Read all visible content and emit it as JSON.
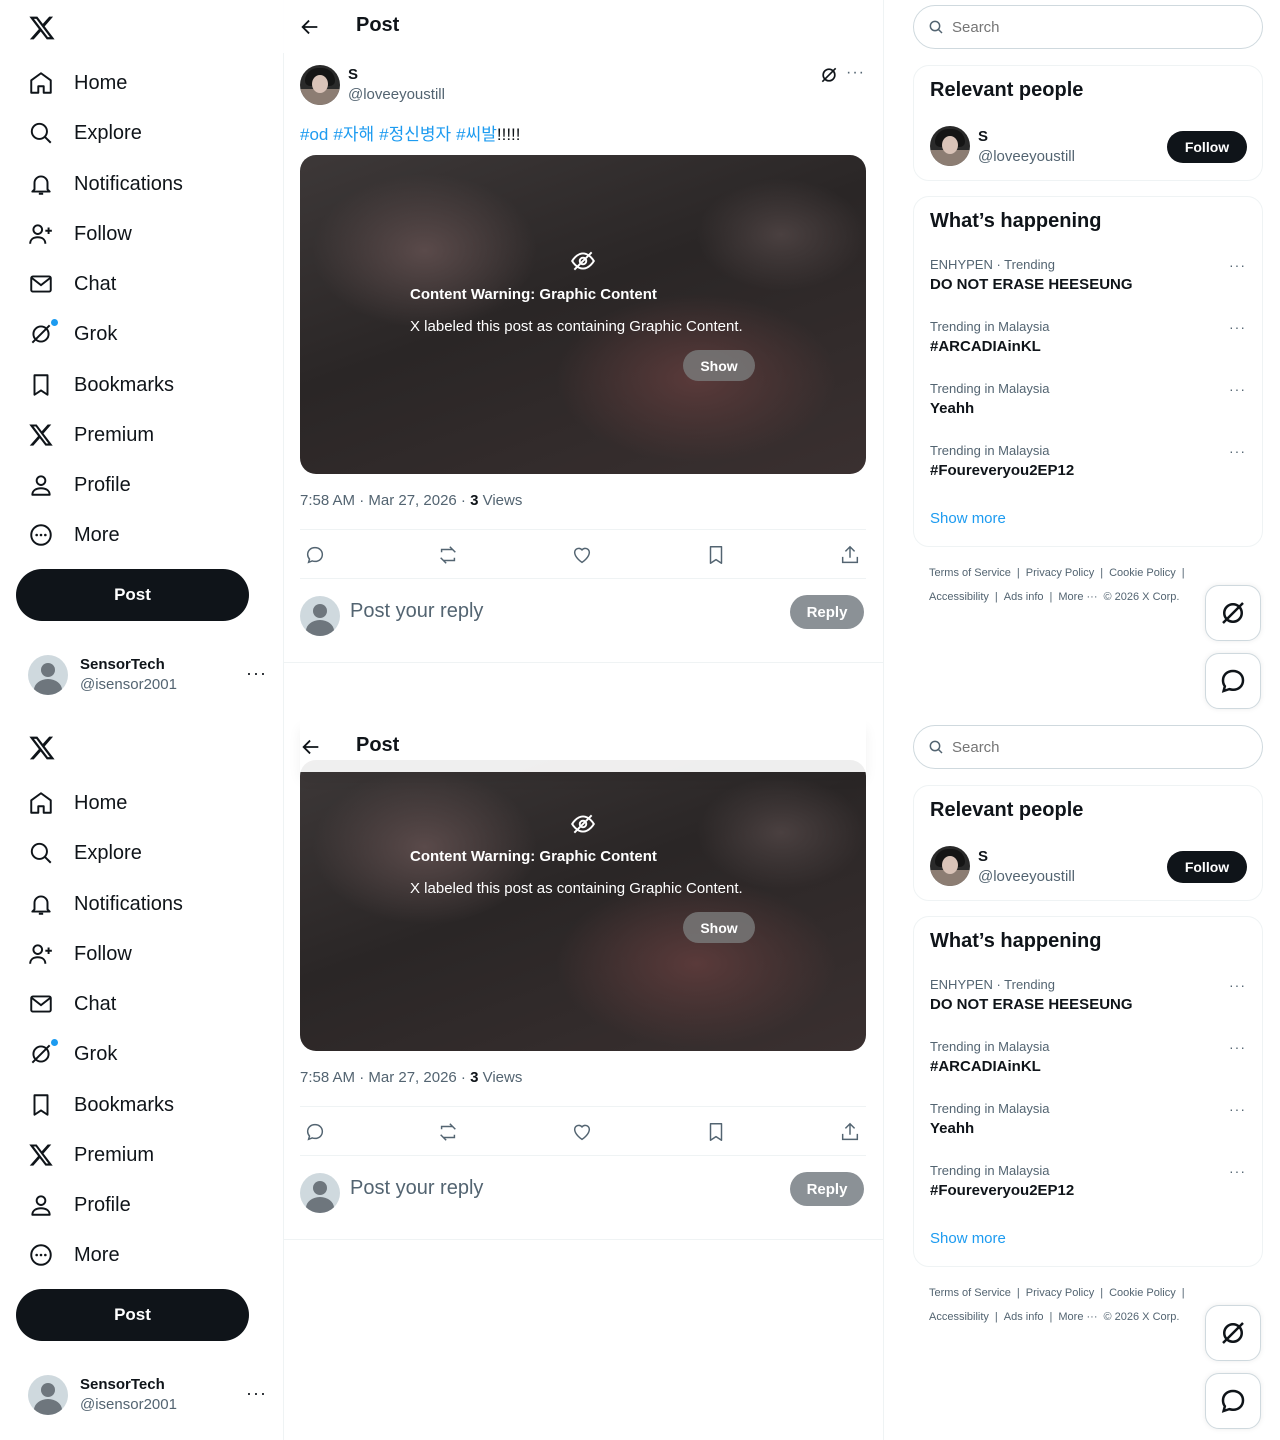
{
  "nav": {
    "items": [
      {
        "label": "Home",
        "icon": "home-icon"
      },
      {
        "label": "Explore",
        "icon": "search-icon"
      },
      {
        "label": "Notifications",
        "icon": "bell-icon"
      },
      {
        "label": "Follow",
        "icon": "add-user-icon"
      },
      {
        "label": "Chat",
        "icon": "envelope-icon"
      },
      {
        "label": "Grok",
        "icon": "grok-icon"
      },
      {
        "label": "Bookmarks",
        "icon": "bookmark-icon"
      },
      {
        "label": "Premium",
        "icon": "x-logo-icon"
      },
      {
        "label": "Profile",
        "icon": "person-icon"
      },
      {
        "label": "More",
        "icon": "more-circle-icon"
      }
    ],
    "post_button": "Post"
  },
  "account": {
    "name": "SensorTech",
    "handle": "@isensor2001",
    "more": "···"
  },
  "header": {
    "title": "Post"
  },
  "tweet": {
    "author_name": "S",
    "author_handle": "@loveeyoustill",
    "more": "···",
    "hashtags": [
      "#od",
      "#자해",
      "#정신병자",
      "#씨발"
    ],
    "text_suffix": "!!!!!",
    "warning_title": "Content Warning: Graphic Content",
    "warning_text": "X labeled this post as containing Graphic Content.",
    "show_label": "Show",
    "time": "7:58 AM · Mar 27, 2026 · ",
    "views_count": "3",
    "views_label": " Views"
  },
  "reply": {
    "placeholder": "Post your reply",
    "button": "Reply"
  },
  "search": {
    "placeholder": "Search"
  },
  "relevant": {
    "title": "Relevant people",
    "name": "S",
    "handle": "@loveeyoustill",
    "follow_label": "Follow"
  },
  "happening": {
    "title": "What’s happening",
    "trends": [
      {
        "context": "ENHYPEN · Trending",
        "name": "DO NOT ERASE HEESEUNG"
      },
      {
        "context": "Trending in Malaysia",
        "name": "#ARCADIAinKL"
      },
      {
        "context": "Trending in Malaysia",
        "name": "Yeahh"
      },
      {
        "context": "Trending in Malaysia",
        "name": "#Foureveryou2EP12"
      }
    ],
    "show_more": "Show more",
    "more": "···"
  },
  "footer": {
    "links": [
      "Terms of Service",
      "|",
      "Privacy Policy",
      "|",
      "Cookie Policy",
      "|"
    ],
    "links2": [
      "Accessibility",
      "|",
      "Ads info",
      "|",
      "More ···",
      "© 2026 X Corp."
    ]
  },
  "colors": {
    "accent": "#1d9bf0",
    "primary": "#0f1419",
    "secondary": "#536471"
  }
}
